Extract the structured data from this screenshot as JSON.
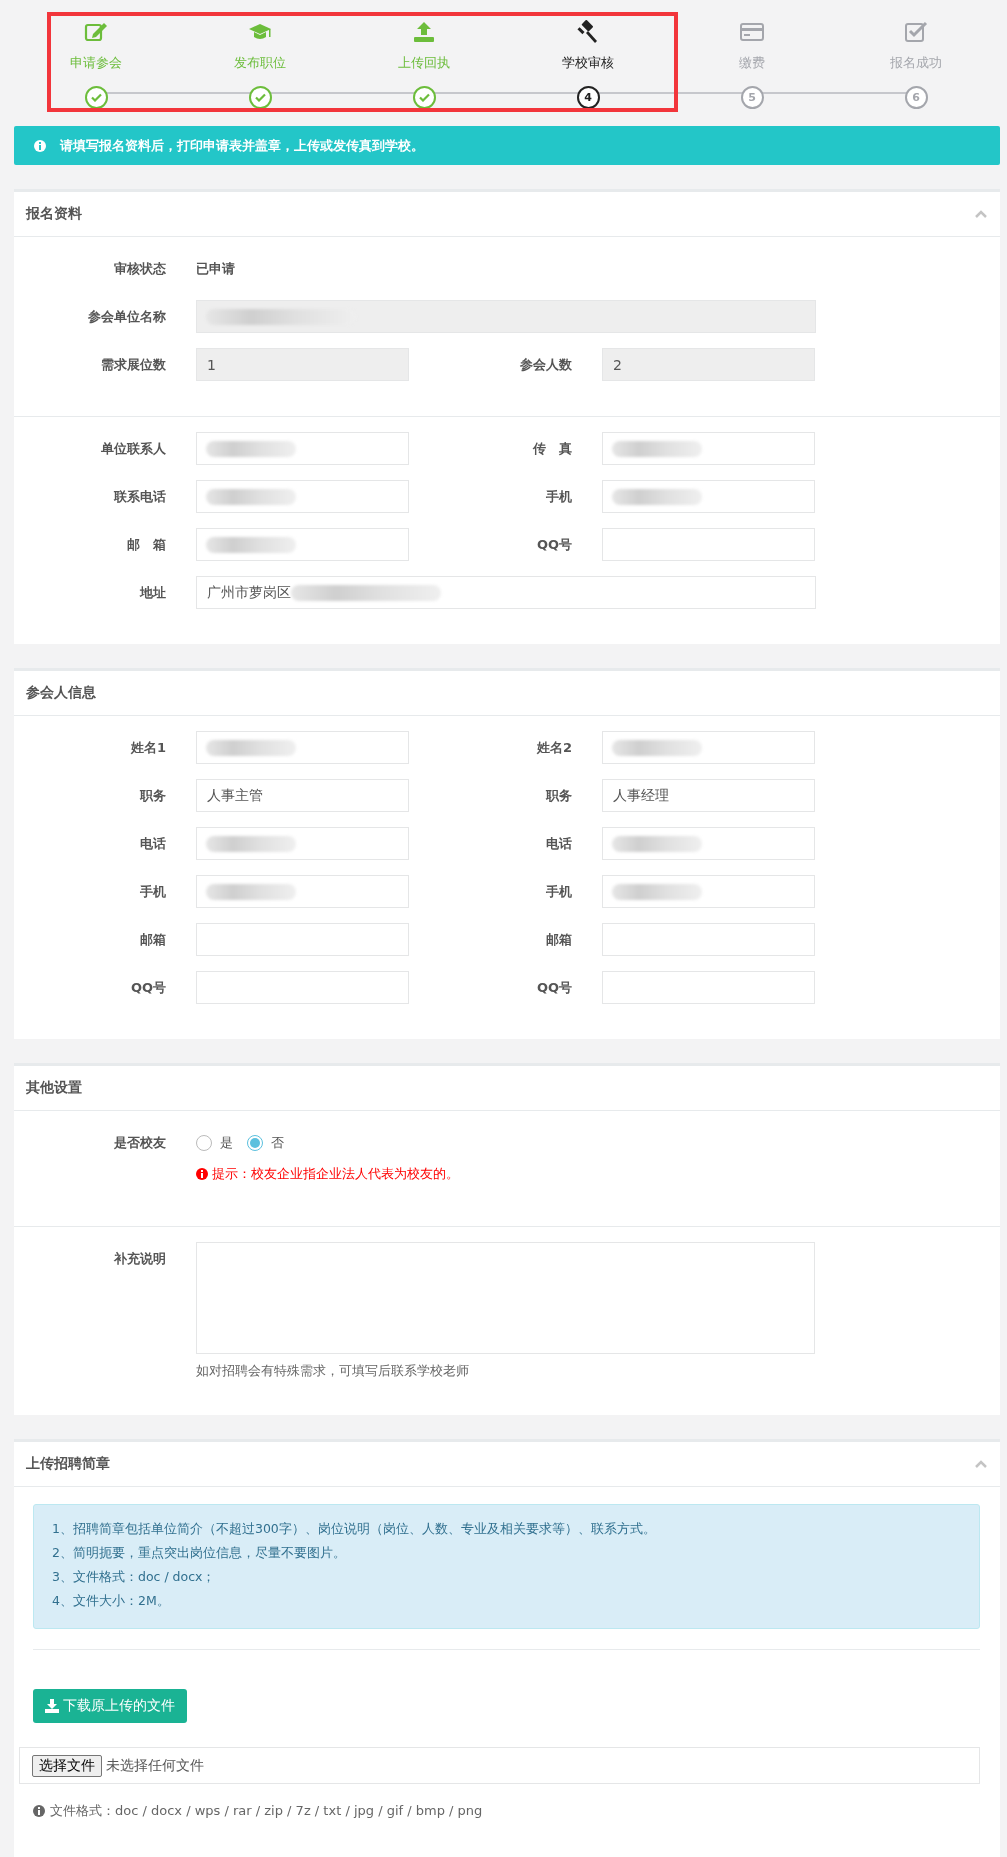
{
  "steps": [
    {
      "label": "申请参会",
      "done": true,
      "current": false,
      "highlighted": true
    },
    {
      "label": "发布职位",
      "done": true,
      "current": false,
      "highlighted": true
    },
    {
      "label": "上传回执",
      "done": true,
      "current": false,
      "highlighted": true
    },
    {
      "label": "学校审核",
      "done": false,
      "current": true,
      "number": "4",
      "highlighted": true
    },
    {
      "label": "缴费",
      "done": false,
      "current": false,
      "number": "5",
      "highlighted": false
    },
    {
      "label": "报名成功",
      "done": false,
      "current": false,
      "number": "6",
      "highlighted": false
    }
  ],
  "alert": "请填写报名资料后，打印申请表并盖章，上传或发传真到学校。",
  "panels": [
    {
      "title": "报名资料",
      "collapsible": true,
      "groups": [
        [
          {
            "kind": "status",
            "label": "审核状态",
            "value": "已申请"
          },
          {
            "kind": "fields",
            "fields": [
              {
                "label": "参会单位名称",
                "readonly": true,
                "redacted": true
              }
            ]
          },
          {
            "kind": "fields",
            "fields": [
              {
                "label": "需求展位数",
                "value": "1",
                "readonly": true,
                "redacted": false
              },
              {
                "label": "参会人数",
                "value": "2",
                "readonly": true,
                "redacted": false
              }
            ]
          }
        ],
        [
          {
            "kind": "fields",
            "fields": [
              {
                "label": "单位联系人",
                "readonly": false,
                "redacted": true
              },
              {
                "label": "传　真",
                "readonly": false,
                "redacted": true
              }
            ]
          },
          {
            "kind": "fields",
            "fields": [
              {
                "label": "联系电话",
                "readonly": false,
                "redacted": true
              },
              {
                "label": "手机",
                "readonly": false,
                "redacted": true
              }
            ]
          },
          {
            "kind": "fields",
            "fields": [
              {
                "label": "邮　箱",
                "readonly": false,
                "redacted": true
              },
              {
                "label": "QQ号",
                "readonly": false,
                "redacted": false
              }
            ]
          },
          {
            "kind": "fields",
            "fields": [
              {
                "label": "地址",
                "value": "广州市萝岗区",
                "readonly": false,
                "redacted": true
              }
            ]
          }
        ]
      ]
    },
    {
      "title": "参会人信息",
      "collapsible": false,
      "groups": [
        [
          {
            "kind": "fields",
            "fields": [
              {
                "label": "姓名1",
                "readonly": false,
                "redacted": true
              },
              {
                "label": "姓名2",
                "readonly": false,
                "redacted": true
              }
            ]
          },
          {
            "kind": "fields",
            "fields": [
              {
                "label": "职务",
                "value": "人事主管",
                "readonly": false,
                "redacted": false
              },
              {
                "label": "职务",
                "value": "人事经理",
                "readonly": false,
                "redacted": false
              }
            ]
          },
          {
            "kind": "fields",
            "fields": [
              {
                "label": "电话",
                "readonly": false,
                "redacted": true
              },
              {
                "label": "电话",
                "readonly": false,
                "redacted": true
              }
            ]
          },
          {
            "kind": "fields",
            "fields": [
              {
                "label": "手机",
                "readonly": false,
                "redacted": true
              },
              {
                "label": "手机",
                "readonly": false,
                "redacted": true
              }
            ]
          },
          {
            "kind": "fields",
            "fields": [
              {
                "label": "邮箱",
                "readonly": false,
                "redacted": false
              },
              {
                "label": "邮箱",
                "readonly": false,
                "redacted": false
              }
            ]
          },
          {
            "kind": "fields",
            "fields": [
              {
                "label": "QQ号",
                "readonly": false,
                "redacted": false
              },
              {
                "label": "QQ号",
                "readonly": false,
                "redacted": false
              }
            ]
          }
        ]
      ]
    },
    {
      "title": "其他设置",
      "collapsible": false,
      "groups": [
        [
          {
            "kind": "radio",
            "label": "是否校友",
            "options": [
              {
                "label": "是",
                "selected": false
              },
              {
                "label": "否",
                "selected": true
              }
            ],
            "tip": "提示：校友企业指企业法人代表为校友的。"
          }
        ],
        [
          {
            "kind": "textarea",
            "label": "补充说明",
            "help": "如对招聘会有特殊需求，可填写后联系学校老师"
          }
        ]
      ]
    },
    {
      "title": "上传招聘简章",
      "collapsible": true,
      "groups": [
        [
          {
            "kind": "notice",
            "lines": [
              "1、招聘简章包括单位简介（不超过300字）、岗位说明（岗位、人数、专业及相关要求等）、联系方式。",
              "2、简明扼要，重点突出岗位信息，尽量不要图片。",
              "3、文件格式：doc / docx；",
              "4、文件大小：2M。"
            ]
          },
          {
            "kind": "download",
            "label": "下载原上传的文件"
          },
          {
            "kind": "file",
            "button": "选择文件",
            "status": "未选择任何文件"
          },
          {
            "kind": "note",
            "text": "文件格式：doc / docx / wps / rar / zip / 7z / txt / jpg / gif / bmp / png"
          }
        ]
      ]
    }
  ]
}
